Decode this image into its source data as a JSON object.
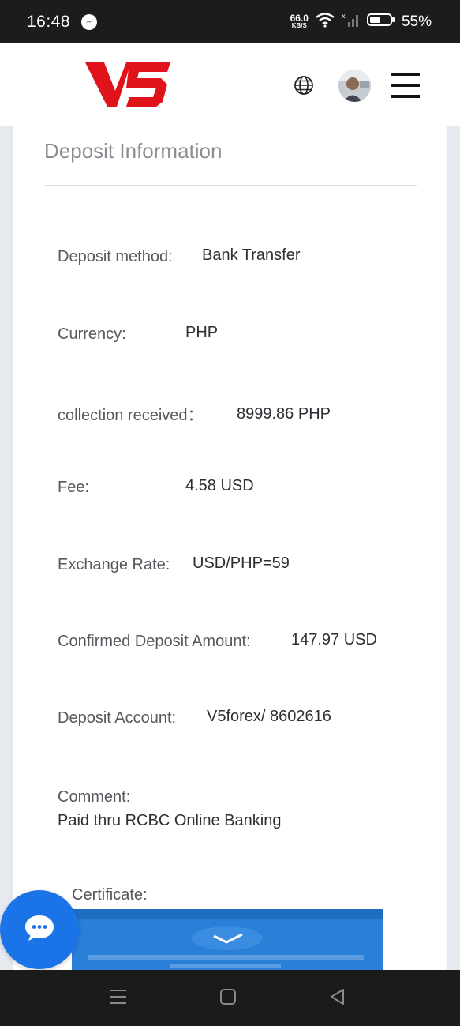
{
  "status_bar": {
    "time": "16:48",
    "net_speed_value": "66.0",
    "net_speed_unit": "KB/S",
    "battery": "55%",
    "icons": [
      "messenger-icon",
      "wifi-icon",
      "signal-icon",
      "battery-icon"
    ]
  },
  "header": {
    "logo_text": "V5",
    "icons": [
      "globe-icon",
      "avatar",
      "menu-icon"
    ]
  },
  "section": {
    "title": "Deposit Information",
    "fields": [
      {
        "label": "Deposit method:",
        "value": "Bank Transfer"
      },
      {
        "label": "Currency:",
        "value": "PHP"
      },
      {
        "label": "collection received：",
        "value": "8999.86 PHP"
      },
      {
        "label": "Fee:",
        "value": "4.58 USD"
      },
      {
        "label": "Exchange Rate:",
        "value": "USD/PHP=59"
      },
      {
        "label": "Confirmed Deposit Amount:",
        "value": "147.97 USD"
      },
      {
        "label": "Deposit Account:",
        "value": "V5forex/ 8602616"
      }
    ],
    "comment_label": "Comment:",
    "comment_value": "Paid thru RCBC Online Banking",
    "certificate_label": "Certificate:"
  },
  "colors": {
    "brand_red": "#e0131b",
    "chat_blue": "#1a74e8",
    "status_bar": "#1e1c1a"
  }
}
